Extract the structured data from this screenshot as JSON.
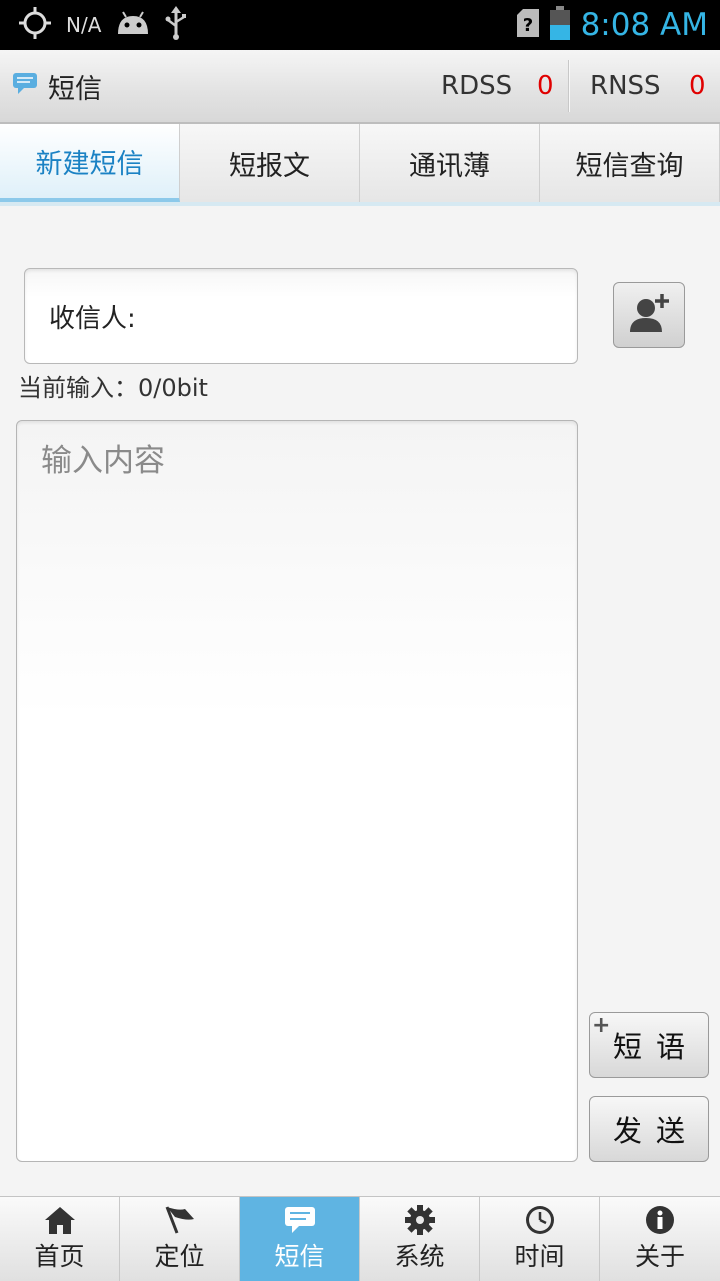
{
  "status_bar": {
    "carrier": "N/A",
    "time": "8:08 AM"
  },
  "header": {
    "title": "短信",
    "rdss_label": "RDSS",
    "rdss_value": "0",
    "rnss_label": "RNSS",
    "rnss_value": "0"
  },
  "tabs": [
    {
      "label": "新建短信",
      "active": true
    },
    {
      "label": "短报文",
      "active": false
    },
    {
      "label": "通讯薄",
      "active": false
    },
    {
      "label": "短信查询",
      "active": false
    }
  ],
  "compose": {
    "recipient_label": "收信人:",
    "input_count": "当前输入：0/0bit",
    "message_placeholder": "输入内容",
    "phrase_button": "短语",
    "send_button": "发送"
  },
  "bottom_nav": [
    {
      "label": "首页",
      "icon": "home-icon",
      "active": false
    },
    {
      "label": "定位",
      "icon": "flag-icon",
      "active": false
    },
    {
      "label": "短信",
      "icon": "message-icon",
      "active": true
    },
    {
      "label": "系统",
      "icon": "gear-icon",
      "active": false
    },
    {
      "label": "时间",
      "icon": "clock-icon",
      "active": false
    },
    {
      "label": "关于",
      "icon": "info-icon",
      "active": false
    }
  ],
  "colors": {
    "accent": "#35b5e5",
    "active_nav": "#5fb4e2",
    "counter_red": "#e00000"
  }
}
